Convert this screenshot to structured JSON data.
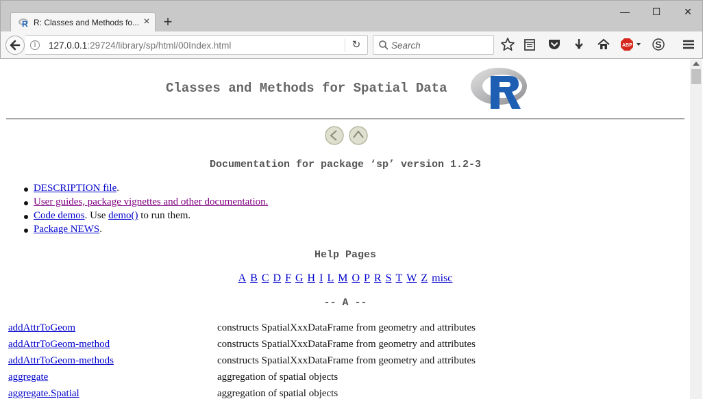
{
  "window": {
    "tab_title": "R: Classes and Methods fo...",
    "tab_close": "×",
    "new_tab": "+",
    "minimize": "—",
    "maximize": "☐",
    "close": "✕"
  },
  "navbar": {
    "url_host": "127.0.0.1",
    "url_rest": ":29724/library/sp/html/00Index.html",
    "search_placeholder": "Search",
    "reload": "↻",
    "adblock_label": "ABP"
  },
  "page": {
    "title": "Classes and Methods for Spatial Data",
    "doc_heading": "Documentation for package ‘sp’ version 1.2-3",
    "links": [
      {
        "link": "DESCRIPTION file",
        "after": "."
      },
      {
        "link": "User guides, package vignettes and other documentation.",
        "after": ""
      },
      {
        "link": "Code demos",
        "mid": ". Use ",
        "link2": "demo()",
        "after": " to run them."
      },
      {
        "link": "Package NEWS",
        "after": "."
      }
    ],
    "help_heading": "Help Pages",
    "letters": [
      "A",
      "B",
      "C",
      "D",
      "F",
      "G",
      "H",
      "I",
      "L",
      "M",
      "O",
      "P",
      "R",
      "S",
      "T",
      "W",
      "Z",
      "misc"
    ],
    "section_a": "-- A --",
    "entries": [
      {
        "name": "addAttrToGeom",
        "desc": "constructs SpatialXxxDataFrame from geometry and attributes"
      },
      {
        "name": "addAttrToGeom-method",
        "desc": "constructs SpatialXxxDataFrame from geometry and attributes"
      },
      {
        "name": "addAttrToGeom-methods",
        "desc": "constructs SpatialXxxDataFrame from geometry and attributes"
      },
      {
        "name": "aggregate",
        "desc": "aggregation of spatial objects"
      },
      {
        "name": "aggregate.Spatial",
        "desc": "aggregation of spatial objects"
      }
    ]
  },
  "colors": {
    "link": "#0000cc",
    "visited_link": "#800080",
    "heading": "#666666",
    "r_blue": "#1f5fb3"
  },
  "icons": [
    "r-favicon-icon",
    "back-arrow-icon",
    "info-icon",
    "reload-icon",
    "search-icon",
    "bookmark-star-icon",
    "reading-list-icon",
    "pocket-icon",
    "download-icon",
    "home-icon",
    "adblock-icon",
    "s-extension-icon",
    "hamburger-menu-icon",
    "left-arrow-icon",
    "up-arrow-icon",
    "r-logo"
  ]
}
